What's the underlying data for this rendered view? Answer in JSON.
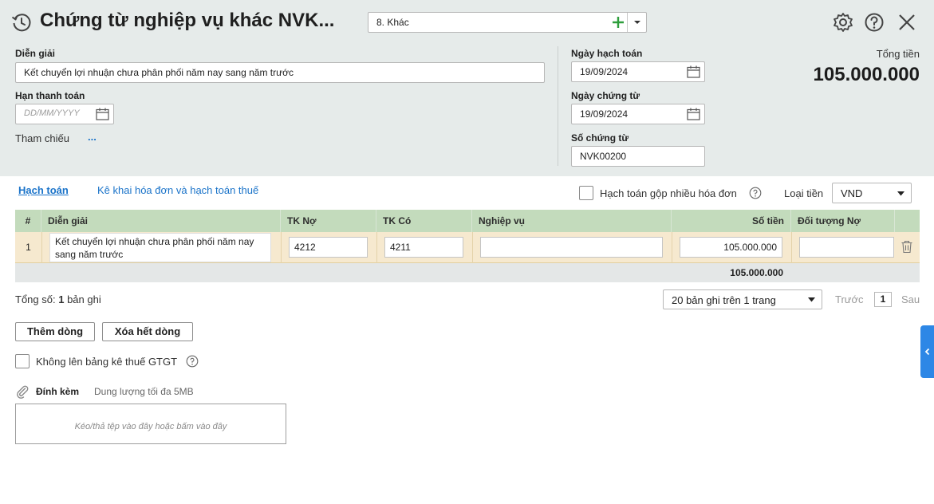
{
  "header": {
    "title": "Chứng từ nghiệp vụ khác NVK...",
    "voucher_type": "8. Khác",
    "total_label": "Tổng tiền",
    "total_value": "105.000.000"
  },
  "form": {
    "description_label": "Diễn giải",
    "description_value": "Kết chuyển lợi nhuận chưa phân phối năm nay sang năm trước",
    "due_date_label": "Hạn thanh toán",
    "due_date_placeholder": "DD/MM/YYYY",
    "reference_label": "Tham chiếu",
    "reference_more": "...",
    "posting_date_label": "Ngày hạch toán",
    "posting_date_value": "19/09/2024",
    "voucher_date_label": "Ngày chứng từ",
    "voucher_date_value": "19/09/2024",
    "voucher_no_label": "Số chứng từ",
    "voucher_no_value": "NVK00200"
  },
  "tabs": {
    "accounting": "Hạch toán",
    "invoice_tax": "Kê khai hóa đơn và hạch toán thuế"
  },
  "options": {
    "merge_invoices_label": "Hạch toán gộp nhiều hóa đơn",
    "currency_label": "Loại tiền",
    "currency_value": "VND"
  },
  "grid": {
    "columns": [
      "#",
      "Diễn giải",
      "TK Nợ",
      "TK Có",
      "Nghiệp vụ",
      "Số tiền",
      "Đối tượng Nợ"
    ],
    "rows": [
      {
        "index": "1",
        "description": "Kết chuyển lợi nhuận chưa phân phối năm nay sang năm trước",
        "debit_account": "4212",
        "credit_account": "4211",
        "operation": "",
        "amount": "105.000.000",
        "debit_object": ""
      }
    ],
    "footer_total": "105.000.000"
  },
  "pagination": {
    "total_prefix": "Tổng số:",
    "total_count": "1",
    "total_suffix": "bản ghi",
    "page_size": "20 bản ghi trên 1 trang",
    "prev": "Trước",
    "current_page": "1",
    "next": "Sau"
  },
  "actions": {
    "add_row": "Thêm dòng",
    "delete_all_rows": "Xóa hết dòng"
  },
  "vat": {
    "exclude_label": "Không lên bảng kê thuế GTGT"
  },
  "attachment": {
    "label": "Đính kèm",
    "note": "Dung lượng tối đa 5MB",
    "dropzone_text": "Kéo/thả tệp vào đây hoặc bấm vào đây"
  },
  "colors": {
    "header_bg": "#e6ebea",
    "grid_header_bg": "#c3dbbc",
    "row_bg": "#f6e9cf",
    "link": "#1a73c9",
    "add_green": "#2e9e3c",
    "side_tab": "#2d87e6"
  },
  "icons": {
    "history": "history-icon",
    "settings": "gear-icon",
    "help": "help-icon",
    "close": "close-icon",
    "calendar": "calendar-icon",
    "delete": "trash-icon",
    "attach": "paperclip-icon"
  }
}
